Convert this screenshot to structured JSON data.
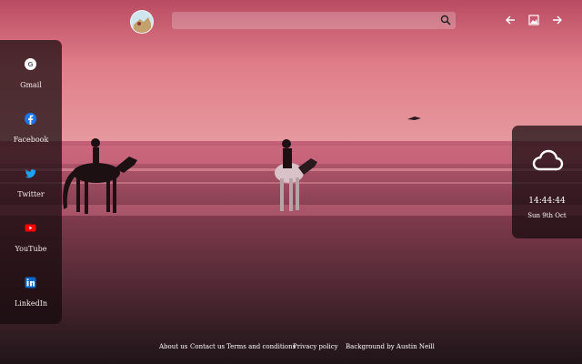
{
  "search": {
    "placeholder": ""
  },
  "nav": {
    "back_icon": "arrow-left-icon",
    "wallpaper_icon": "image-icon",
    "forward_icon": "arrow-right-icon"
  },
  "sidebar": {
    "items": [
      {
        "label": "Gmail",
        "icon": "google-icon",
        "color": "#4285f4"
      },
      {
        "label": "Facebook",
        "icon": "facebook-icon",
        "color": "#1877f2"
      },
      {
        "label": "Twitter",
        "icon": "twitter-icon",
        "color": "#1da1f2"
      },
      {
        "label": "YouTube",
        "icon": "youtube-icon",
        "color": "#ff0000"
      },
      {
        "label": "LinkedIn",
        "icon": "linkedin-icon",
        "color": "#0a66c2"
      }
    ]
  },
  "widget": {
    "weather_icon": "cloud-icon",
    "time": "14:44:44",
    "date": "Sun 9th Oct"
  },
  "footer": {
    "about": "About us",
    "contact": "Contact us",
    "terms": "Terms and conditions",
    "privacy": "Privacy policy",
    "credit": "Background by Austin Neill"
  },
  "colors": {
    "sky_top": "#c95a6e",
    "sky_mid": "#e07a86",
    "sea": "#b95a72",
    "sand_dark": "#2e1a22",
    "panel": "#140a0c"
  }
}
